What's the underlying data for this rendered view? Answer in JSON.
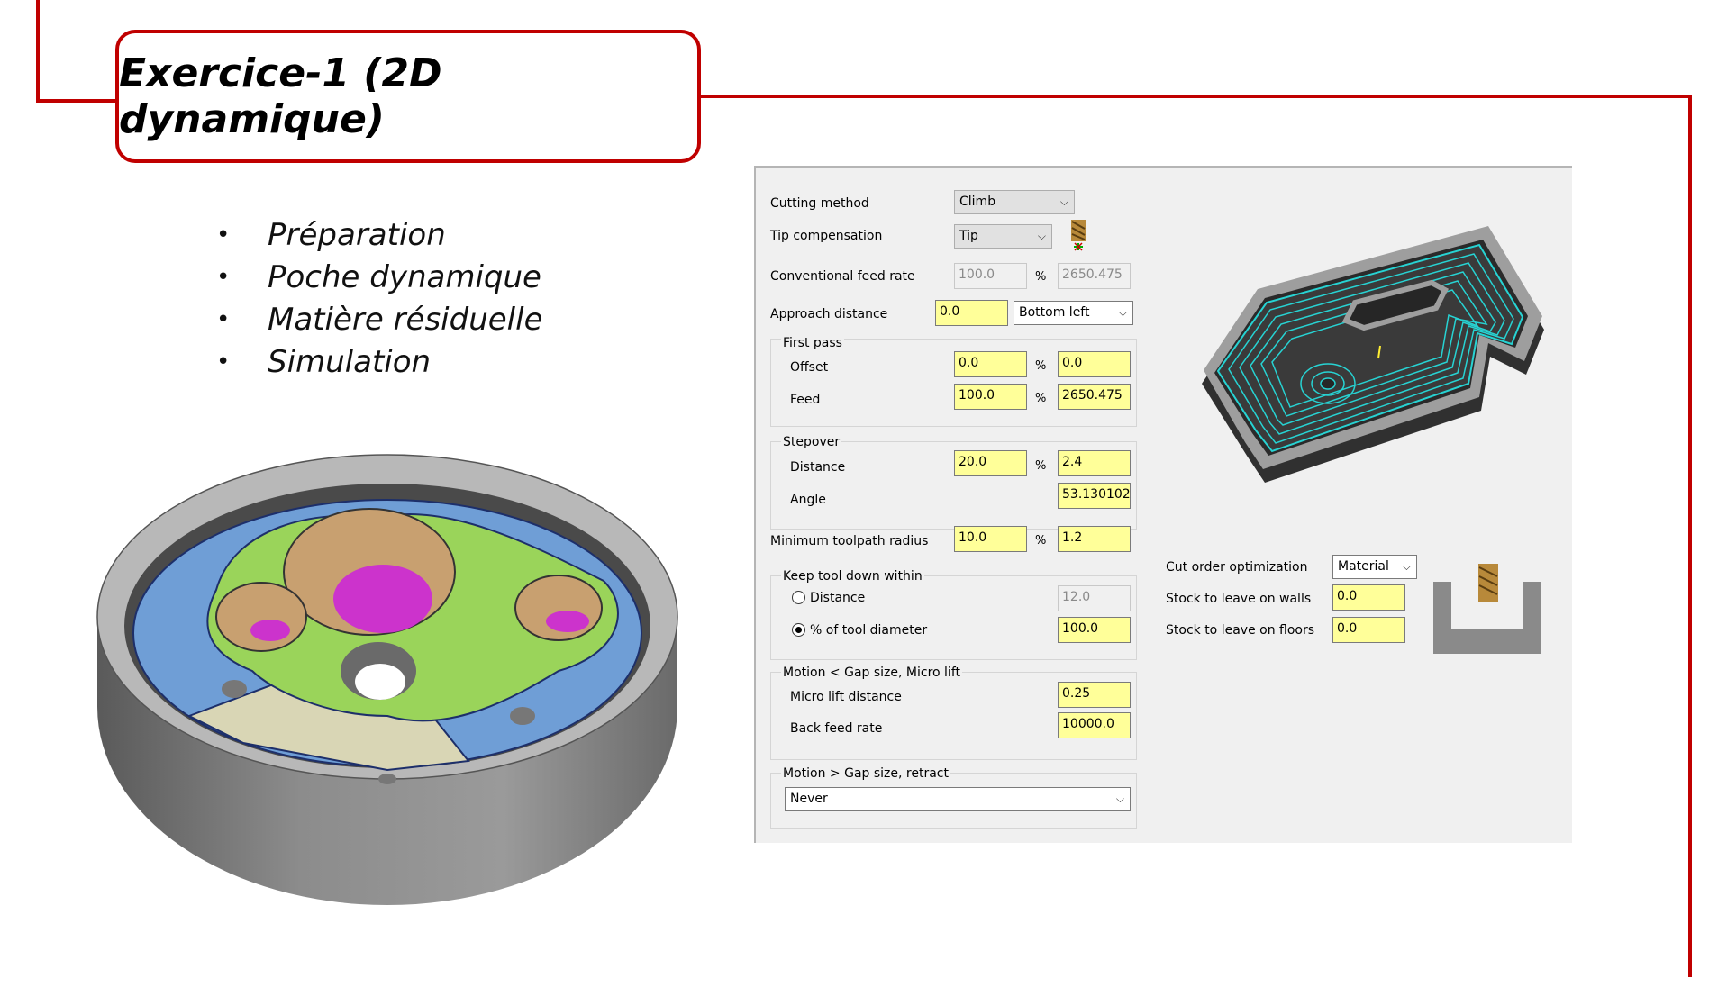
{
  "slide": {
    "title": "Exercice-1 (2D dynamique)",
    "bullets": [
      "Préparation",
      "Poche dynamique",
      "Matière résiduelle",
      "Simulation"
    ]
  },
  "panel": {
    "cutting_method": {
      "label": "Cutting method",
      "value": "Climb"
    },
    "tip_compensation": {
      "label": "Tip compensation",
      "value": "Tip"
    },
    "conventional_feed_rate": {
      "label": "Conventional feed rate",
      "percent": "100.0",
      "value": "2650.475"
    },
    "approach_distance": {
      "label": "Approach distance",
      "value": "0.0",
      "position": "Bottom left"
    },
    "first_pass": {
      "title": "First pass",
      "offset_label": "Offset",
      "offset_percent": "0.0",
      "offset_value": "0.0",
      "feed_label": "Feed",
      "feed_percent": "100.0",
      "feed_value": "2650.475"
    },
    "stepover": {
      "title": "Stepover",
      "distance_label": "Distance",
      "distance_percent": "20.0",
      "distance_value": "2.4",
      "angle_label": "Angle",
      "angle_value": "53.130102"
    },
    "min_toolpath_radius": {
      "label": "Minimum toolpath radius",
      "percent": "10.0",
      "value": "1.2"
    },
    "keep_tool_down": {
      "title": "Keep tool down within",
      "distance_label": "Distance",
      "distance_value": "12.0",
      "percent_label": "% of tool diameter",
      "percent_value": "100.0"
    },
    "micro_lift": {
      "title": "Motion < Gap size, Micro lift",
      "distance_label": "Micro lift distance",
      "distance_value": "0.25",
      "feed_label": "Back feed rate",
      "feed_value": "10000.0"
    },
    "retract": {
      "title": "Motion > Gap size, retract",
      "value": "Never"
    },
    "cut_order": {
      "label": "Cut order optimization",
      "value": "Material"
    },
    "stock_walls": {
      "label": "Stock to leave on walls",
      "value": "0.0"
    },
    "stock_floors": {
      "label": "Stock to leave on floors",
      "value": "0.0"
    },
    "percent_sign": "%"
  },
  "colors": {
    "frame": "#c00000",
    "field": "#ffff99",
    "toolpath": "#27d3d3"
  }
}
